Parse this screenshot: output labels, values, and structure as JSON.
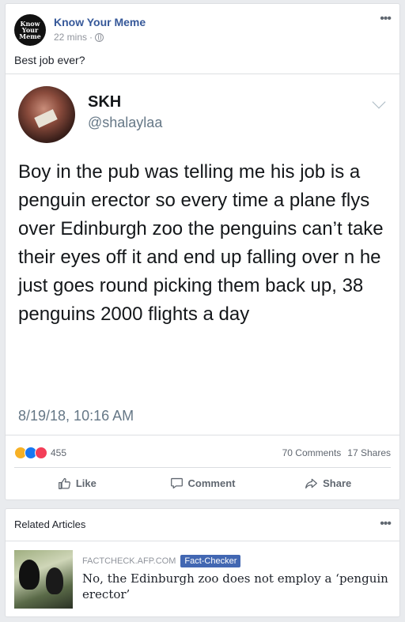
{
  "post": {
    "page_name": "Know Your Meme",
    "avatar_text": "Know Your Meme",
    "time": "22 mins",
    "separator": "·",
    "more": "•••",
    "text": "Best job ever?"
  },
  "tweet": {
    "name": "SKH",
    "handle": "@shalaylaa",
    "body": "Boy in the pub was telling me his job is a penguin erector so every time a plane flys over Edinburgh zoo the penguins can’t take their eyes off it and end up falling over n he just goes round picking them back up, 38 penguins 2000 flights a day",
    "date": "8/19/18, 10:16 AM"
  },
  "stats": {
    "reaction_count": "455",
    "comments": "70 Comments",
    "shares": "17 Shares",
    "reaction_icons": [
      "haha-icon",
      "like-icon",
      "love-icon"
    ],
    "colors": {
      "haha": "#f7b125",
      "like": "#1877f2",
      "love": "#f33e58"
    }
  },
  "actions": {
    "like": "Like",
    "comment": "Comment",
    "share": "Share"
  },
  "related": {
    "title": "Related Articles",
    "more": "•••",
    "source": "FACTCHECK.AFP.COM",
    "badge": "Fact-Checker",
    "headline": "No, the Edinburgh zoo does not employ a ‘penguin erector’"
  }
}
